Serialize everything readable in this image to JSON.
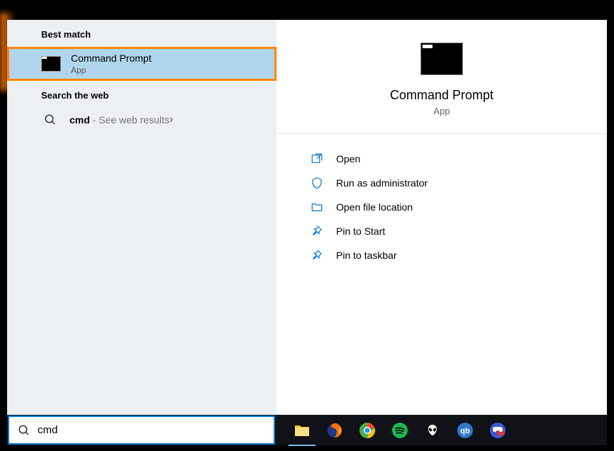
{
  "left": {
    "bestMatchHeader": "Best match",
    "bestMatch": {
      "title": "Command Prompt",
      "subtitle": "App"
    },
    "webHeader": "Search the web",
    "webResult": {
      "term": "cmd",
      "suffix": " - See web results"
    }
  },
  "preview": {
    "title": "Command Prompt",
    "subtitle": "App",
    "actions": [
      "Open",
      "Run as administrator",
      "Open file location",
      "Pin to Start",
      "Pin to taskbar"
    ]
  },
  "search": {
    "value": "cmd"
  },
  "taskbar": {
    "apps": [
      "file-explorer",
      "firefox",
      "chrome",
      "spotify",
      "foobar",
      "qbittorrent",
      "games"
    ]
  }
}
